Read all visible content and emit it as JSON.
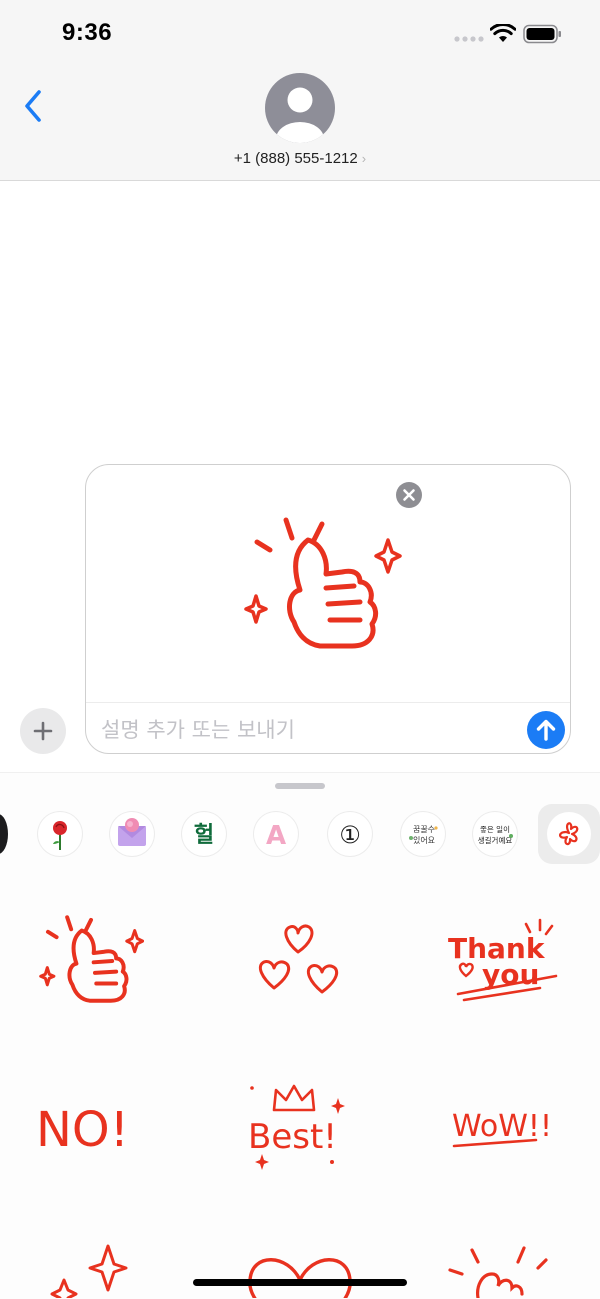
{
  "status_bar": {
    "time": "9:36"
  },
  "header": {
    "back_icon": "chevron-left-icon",
    "avatar_icon": "person-silhouette-icon",
    "contact_number": "+1 (888) 555-1212",
    "contact_chevron": "›"
  },
  "compose": {
    "placeholder": "설명 추가 또는 보내기",
    "value": "",
    "attachment": "thumbs-up-sticker",
    "remove_icon": "close-icon",
    "plus_icon": "plus-icon",
    "send_icon": "arrow-up-icon"
  },
  "sticker_tray": {
    "packs": [
      "rose",
      "envelope",
      "헐",
      "A",
      "①",
      "꿈꿀 수 있어요",
      "좋은 일이 생길거예요",
      "red-clover"
    ],
    "selected_index": 7
  },
  "stickers": {
    "items": [
      "thumbs-up",
      "hearts",
      "Thank you",
      "NO!",
      "Best!",
      "WoW!!",
      "sparkles",
      "heart",
      "thumbs-up-2"
    ],
    "thank": "Thank",
    "you": "you",
    "no": "NO!",
    "best": "Best!",
    "wow": "WoW!!"
  },
  "tray_text": {
    "heol": "헐",
    "a": "A",
    "circled_one": "①",
    "dream_1": "꿈꿀수",
    "dream_2": "있어요",
    "good_1": "좋은 일이",
    "good_2": "생길거예요"
  },
  "colors": {
    "accent": "#1b7cf5",
    "sticker_red": "#e8321f",
    "header_bg": "#f6f6f6"
  }
}
